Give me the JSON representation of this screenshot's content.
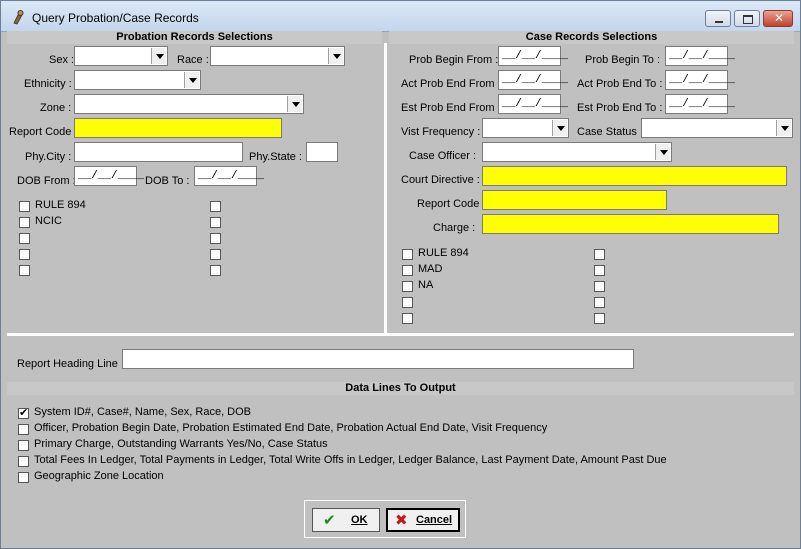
{
  "window": {
    "title": "Query Probation/Case Records"
  },
  "probation": {
    "header": "Probation Records Selections",
    "sex_label": "Sex :",
    "race_label": "Race :",
    "ethnicity_label": "Ethnicity :",
    "zone_label": "Zone :",
    "report_code_label": "Report Code",
    "phy_city_label": "Phy.City :",
    "phy_state_label": "Phy.State :",
    "dob_from_label": "DOB From :",
    "dob_to_label": "DOB To :",
    "dob_from_value": "__/__/____",
    "dob_to_value": "__/__/____",
    "check_left": [
      "RULE 894",
      "NCIC",
      "",
      "",
      ""
    ],
    "check_right": [
      "",
      "",
      "",
      "",
      ""
    ]
  },
  "case": {
    "header": "Case Records Selections",
    "prob_begin_from_label": "Prob Begin From :",
    "prob_begin_to_label": "Prob Begin To :",
    "act_end_from_label": "Act Prob End From :",
    "act_end_to_label": "Act Prob End To :",
    "est_end_from_label": "Est Prob End From :",
    "est_end_to_label": "Est Prob End To :",
    "date_value": "__/__/____",
    "visit_frequency_label": "Vist Frequency :",
    "case_status_label": "Case Status :",
    "case_officer_label": "Case Officer :",
    "court_directive_label": "Court Directive :",
    "report_code_label": "Report Code",
    "charge_label": "Charge :",
    "check_left": [
      "RULE 894",
      "MAD",
      "NA",
      "",
      ""
    ],
    "check_right": [
      "",
      "",
      "",
      "",
      ""
    ]
  },
  "report_heading_label": "Report Heading Line :",
  "data_lines": {
    "header": "Data Lines To Output",
    "items": [
      {
        "label": "System ID#, Case#, Name, Sex, Race, DOB",
        "checked": true
      },
      {
        "label": "Officer, Probation Begin Date, Probation Estimated End Date, Probation Actual End Date, Visit Frequency",
        "checked": false
      },
      {
        "label": "Primary Charge, Outstanding Warrants Yes/No, Case Status",
        "checked": false
      },
      {
        "label": "Total Fees In Ledger, Total Payments in Ledger, Total Write Offs in Ledger, Ledger Balance,  Last Payment Date, Amount Past Due",
        "checked": false
      },
      {
        "label": "Geographic Zone Location",
        "checked": false
      }
    ]
  },
  "buttons": {
    "ok": "OK",
    "cancel": "Cancel"
  },
  "colors": {
    "highlight_field": "#ffff00",
    "window_bg": "#c0c0c0"
  }
}
